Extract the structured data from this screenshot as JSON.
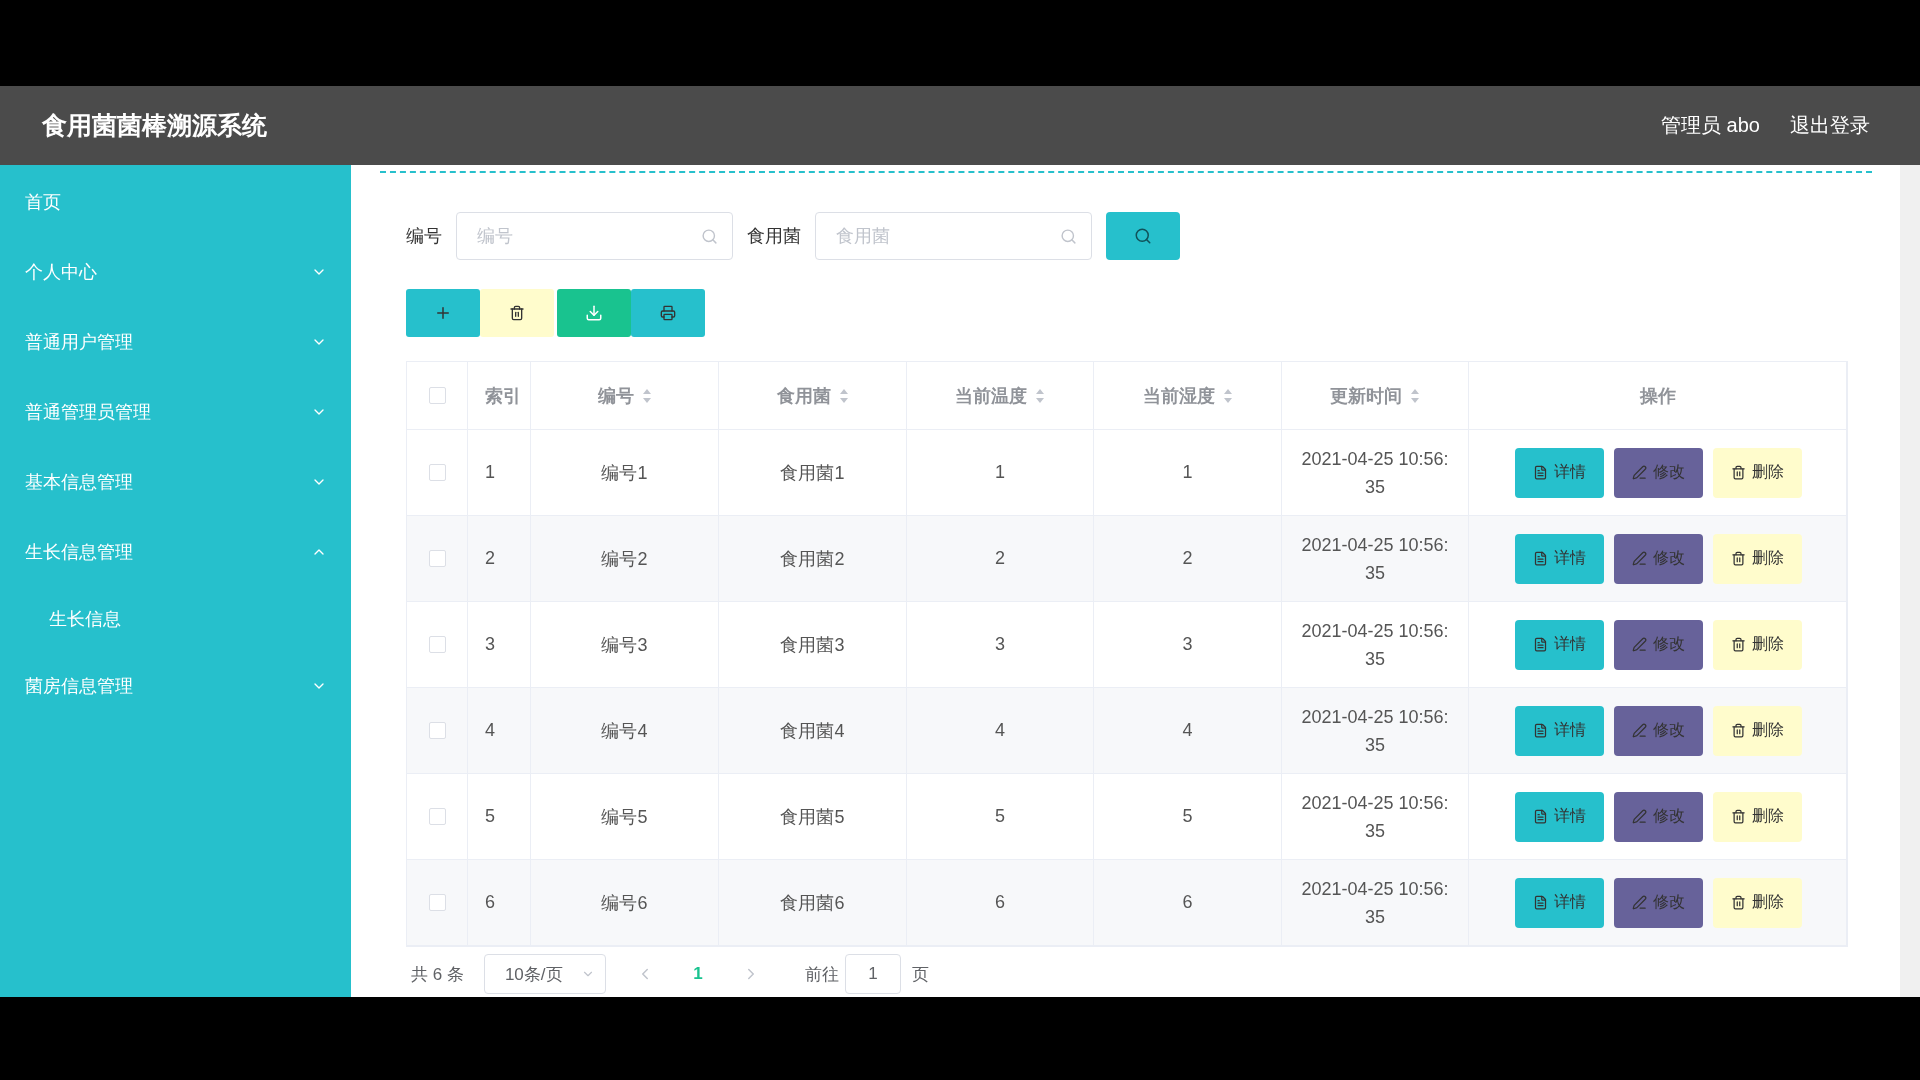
{
  "header": {
    "title": "食用菌菌棒溯源系统",
    "user": "管理员 abo",
    "logout": "退出登录"
  },
  "sidebar": {
    "items": [
      {
        "label": "首页",
        "kind": "link"
      },
      {
        "label": "个人中心",
        "kind": "menu",
        "expanded": false
      },
      {
        "label": "普通用户管理",
        "kind": "menu",
        "expanded": false
      },
      {
        "label": "普通管理员管理",
        "kind": "menu",
        "expanded": false
      },
      {
        "label": "基本信息管理",
        "kind": "menu",
        "expanded": false
      },
      {
        "label": "生长信息管理",
        "kind": "menu",
        "expanded": true,
        "children": [
          {
            "label": "生长信息"
          }
        ]
      },
      {
        "label": "菌房信息管理",
        "kind": "menu",
        "expanded": false
      }
    ]
  },
  "search": {
    "fields": [
      {
        "label": "编号",
        "placeholder": "编号"
      },
      {
        "label": "食用菌",
        "placeholder": "食用菌"
      }
    ]
  },
  "toolbar": {
    "buttons": [
      {
        "kind": "add"
      },
      {
        "kind": "delete"
      },
      {
        "kind": "export"
      },
      {
        "kind": "print"
      }
    ]
  },
  "table": {
    "select_all": {
      "checked": false
    },
    "columns": [
      {
        "label": "索引",
        "sortable": false
      },
      {
        "label": "编号",
        "sortable": true
      },
      {
        "label": "食用菌",
        "sortable": true
      },
      {
        "label": "当前温度",
        "sortable": true
      },
      {
        "label": "当前湿度",
        "sortable": true
      },
      {
        "label": "更新时间",
        "sortable": true
      },
      {
        "label": "操作",
        "sortable": false
      }
    ],
    "rows": [
      {
        "checked": false,
        "cells": [
          "1",
          "编号1",
          "食用菌1",
          "1",
          "1",
          "2021-04-25 10:56:35"
        ],
        "actions": [
          {
            "kind": "detail",
            "label": "详情"
          },
          {
            "kind": "edit",
            "label": "修改"
          },
          {
            "kind": "delete",
            "label": "删除"
          }
        ]
      },
      {
        "checked": false,
        "cells": [
          "2",
          "编号2",
          "食用菌2",
          "2",
          "2",
          "2021-04-25 10:56:35"
        ],
        "actions": [
          {
            "kind": "detail",
            "label": "详情"
          },
          {
            "kind": "edit",
            "label": "修改"
          },
          {
            "kind": "delete",
            "label": "删除"
          }
        ]
      },
      {
        "checked": false,
        "cells": [
          "3",
          "编号3",
          "食用菌3",
          "3",
          "3",
          "2021-04-25 10:56:35"
        ],
        "actions": [
          {
            "kind": "detail",
            "label": "详情"
          },
          {
            "kind": "edit",
            "label": "修改"
          },
          {
            "kind": "delete",
            "label": "删除"
          }
        ]
      },
      {
        "checked": false,
        "cells": [
          "4",
          "编号4",
          "食用菌4",
          "4",
          "4",
          "2021-04-25 10:56:35"
        ],
        "actions": [
          {
            "kind": "detail",
            "label": "详情"
          },
          {
            "kind": "edit",
            "label": "修改"
          },
          {
            "kind": "delete",
            "label": "删除"
          }
        ]
      },
      {
        "checked": false,
        "cells": [
          "5",
          "编号5",
          "食用菌5",
          "5",
          "5",
          "2021-04-25 10:56:35"
        ],
        "actions": [
          {
            "kind": "detail",
            "label": "详情"
          },
          {
            "kind": "edit",
            "label": "修改"
          },
          {
            "kind": "delete",
            "label": "删除"
          }
        ]
      },
      {
        "checked": false,
        "cells": [
          "6",
          "编号6",
          "食用菌6",
          "6",
          "6",
          "2021-04-25 10:56:35"
        ],
        "actions": [
          {
            "kind": "detail",
            "label": "详情"
          },
          {
            "kind": "edit",
            "label": "修改"
          },
          {
            "kind": "delete",
            "label": "删除"
          }
        ]
      }
    ]
  },
  "pagination": {
    "total": "共 6 条",
    "page_size": "10条/页",
    "pages": [
      {
        "label": "1",
        "selected": true
      }
    ],
    "goto_label": "前往",
    "goto_value": "1",
    "goto_suffix": "页"
  }
}
